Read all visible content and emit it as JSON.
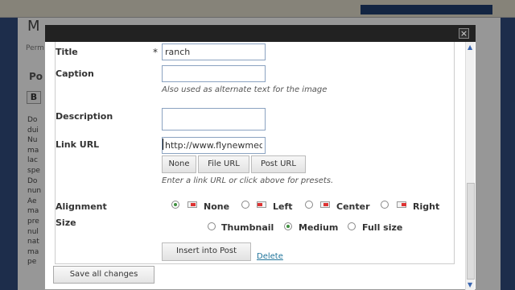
{
  "background": {
    "title": "M",
    "permalink_label": "Perm",
    "post_label": "Po",
    "bold_button": "B",
    "content_fragments": [
      "Do",
      "dui",
      "Nu",
      "ma",
      "lac",
      "spe",
      "Do",
      "nun",
      "Ae",
      "ma",
      "pre",
      "nul",
      "nat",
      "ma",
      "pe"
    ]
  },
  "modal": {
    "close_label": "×",
    "fields": {
      "title": {
        "label": "Title",
        "required_mark": "*",
        "value": "ranch"
      },
      "caption": {
        "label": "Caption",
        "value": "",
        "help": "Also used as alternate text for the image"
      },
      "description": {
        "label": "Description",
        "value": ""
      },
      "link_url": {
        "label": "Link URL",
        "value": "http://www.flynewmed",
        "buttons": [
          "None",
          "File URL",
          "Post URL"
        ],
        "help": "Enter a link URL or click above for presets."
      }
    },
    "alignment": {
      "label": "Alignment",
      "selected": "None",
      "options": [
        "None",
        "Left",
        "Center",
        "Right"
      ]
    },
    "size": {
      "label": "Size",
      "selected": "Medium",
      "options": [
        "Thumbnail",
        "Medium",
        "Full size"
      ]
    },
    "insert_button": "Insert into Post",
    "delete_link": "Delete",
    "save_all_button": "Save all changes"
  },
  "colors": {
    "accent_link": "#21759b",
    "radio_selected": "#3e8f3e",
    "modal_titlebar": "#222222"
  }
}
